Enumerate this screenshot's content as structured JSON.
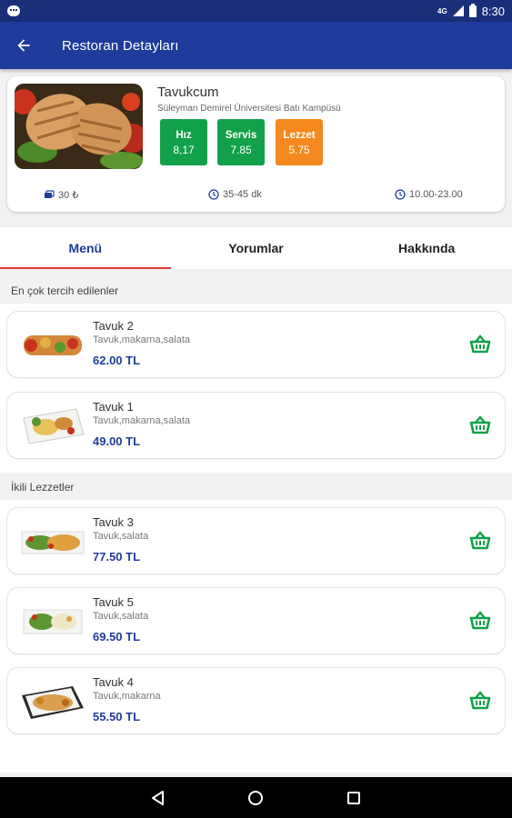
{
  "status_bar": {
    "network": "4G",
    "time": "8:30"
  },
  "app_bar": {
    "title": "Restoran Detayları"
  },
  "restaurant": {
    "name": "Tavukcum",
    "address": "Süleyman Demirel Üniversitesi Batı Kampüsü",
    "scores": [
      {
        "label": "Hız",
        "value": "8,17",
        "color": "#12a14a"
      },
      {
        "label": "Servis",
        "value": "7.85",
        "color": "#12a14a"
      },
      {
        "label": "Lezzet",
        "value": "5.75",
        "color": "#f4891f"
      }
    ],
    "min_order": "30 ₺",
    "delivery_time": "35-45 dk",
    "hours": "10.00-23.00"
  },
  "tabs": [
    {
      "label": "Menü",
      "active": true
    },
    {
      "label": "Yorumlar",
      "active": false
    },
    {
      "label": "Hakkında",
      "active": false
    }
  ],
  "sections": [
    {
      "title": "En çok tercih edilenler",
      "items": [
        {
          "name": "Tavuk 2",
          "desc": "Tavuk,makarna,salata",
          "price": "62.00 TL"
        },
        {
          "name": "Tavuk 1",
          "desc": "Tavuk,makarna,salata",
          "price": "49.00 TL"
        }
      ]
    },
    {
      "title": "İkili Lezzetler",
      "items": [
        {
          "name": "Tavuk 3",
          "desc": "Tavuk,salata",
          "price": "77.50 TL"
        },
        {
          "name": "Tavuk 5",
          "desc": "Tavuk,salata",
          "price": "69.50 TL"
        },
        {
          "name": "Tavuk 4",
          "desc": "Tavuk,makarna",
          "price": "55.50 TL"
        }
      ]
    }
  ],
  "colors": {
    "primary": "#1f3c9c",
    "status_bar": "#1a2e7a",
    "accent_green": "#12a14a",
    "accent_orange": "#f4891f",
    "tab_indicator": "#e03a3a"
  }
}
